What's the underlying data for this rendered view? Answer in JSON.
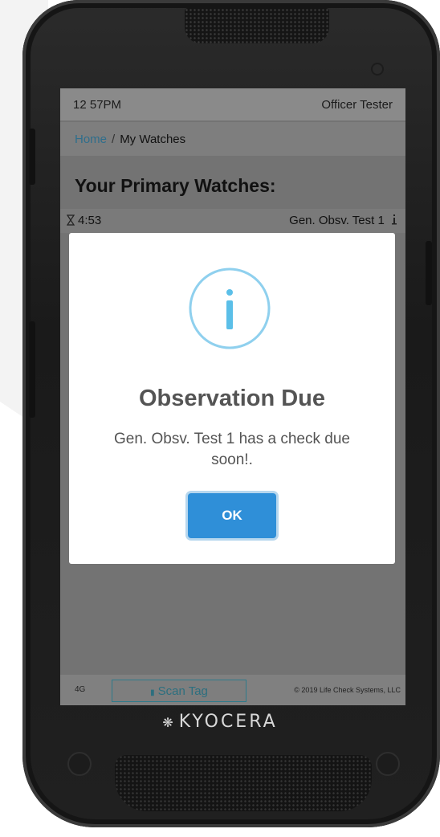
{
  "status_bar": {
    "time": "12 57PM",
    "user": "Officer Tester"
  },
  "breadcrumb": {
    "home": "Home",
    "separator": "/",
    "current": "My Watches"
  },
  "section_title": "Your Primary Watches:",
  "watch": {
    "timer_icon": "hourglass-icon",
    "timer": "4:53",
    "name": "Gen. Obsv. Test 1",
    "info_icon": "info-icon"
  },
  "modal": {
    "icon": "info-circle-icon",
    "title": "Observation Due",
    "message": "Gen. Obsv. Test 1 has a check due soon!.",
    "ok_label": "OK"
  },
  "bottom_bar": {
    "network": "4G",
    "scan_label": "Scan Tag",
    "scan_icon": "tag-icon",
    "copyright": "© 2019 Life Check Systems, LLC"
  },
  "device": {
    "brand": "KYOCERA"
  },
  "colors": {
    "accent": "#2f8fd8",
    "info_ring": "#8fd0ee",
    "overlay": "#737373"
  }
}
